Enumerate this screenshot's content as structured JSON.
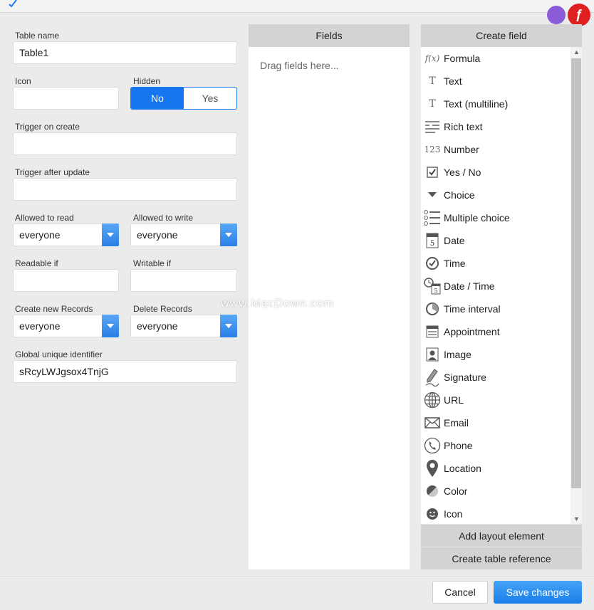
{
  "form": {
    "table_name_label": "Table name",
    "table_name_value": "Table1",
    "icon_label": "Icon",
    "hidden_label": "Hidden",
    "hidden_no": "No",
    "hidden_yes": "Yes",
    "trigger_create_label": "Trigger on create",
    "trigger_update_label": "Trigger after update",
    "allowed_read_label": "Allowed to read",
    "allowed_read_value": "everyone",
    "allowed_write_label": "Allowed to write",
    "allowed_write_value": "everyone",
    "readable_if_label": "Readable if",
    "writable_if_label": "Writable if",
    "create_records_label": "Create new Records",
    "create_records_value": "everyone",
    "delete_records_label": "Delete Records",
    "delete_records_value": "everyone",
    "guid_label": "Global unique identifier",
    "guid_value": "sRcyLWJgsox4TnjG"
  },
  "fields_panel": {
    "title": "Fields",
    "placeholder": "Drag fields here..."
  },
  "create_panel": {
    "title": "Create field",
    "items": [
      {
        "label": "Formula",
        "icon": "formula-icon"
      },
      {
        "label": "Text",
        "icon": "text-icon"
      },
      {
        "label": "Text (multiline)",
        "icon": "text-multiline-icon"
      },
      {
        "label": "Rich text",
        "icon": "rich-text-icon"
      },
      {
        "label": "Number",
        "icon": "number-icon"
      },
      {
        "label": "Yes / No",
        "icon": "checkbox-icon"
      },
      {
        "label": "Choice",
        "icon": "caret-down-icon"
      },
      {
        "label": "Multiple choice",
        "icon": "list-icon"
      },
      {
        "label": "Date",
        "icon": "calendar-icon"
      },
      {
        "label": "Time",
        "icon": "clock-icon"
      },
      {
        "label": "Date / Time",
        "icon": "datetime-icon"
      },
      {
        "label": "Time interval",
        "icon": "interval-icon"
      },
      {
        "label": "Appointment",
        "icon": "appointment-icon"
      },
      {
        "label": "Image",
        "icon": "image-icon"
      },
      {
        "label": "Signature",
        "icon": "pen-icon"
      },
      {
        "label": "URL",
        "icon": "globe-icon"
      },
      {
        "label": "Email",
        "icon": "envelope-icon"
      },
      {
        "label": "Phone",
        "icon": "phone-icon"
      },
      {
        "label": "Location",
        "icon": "pin-icon"
      },
      {
        "label": "Color",
        "icon": "color-icon"
      },
      {
        "label": "Icon",
        "icon": "smiley-icon"
      }
    ],
    "add_layout": "Add layout element",
    "create_reference": "Create table reference"
  },
  "footer": {
    "cancel": "Cancel",
    "save": "Save changes"
  },
  "watermark": "www.MacDown.com",
  "colors": {
    "accent": "#1676f0",
    "panel_header": "#d3d3d3",
    "background": "#ebebeb"
  }
}
